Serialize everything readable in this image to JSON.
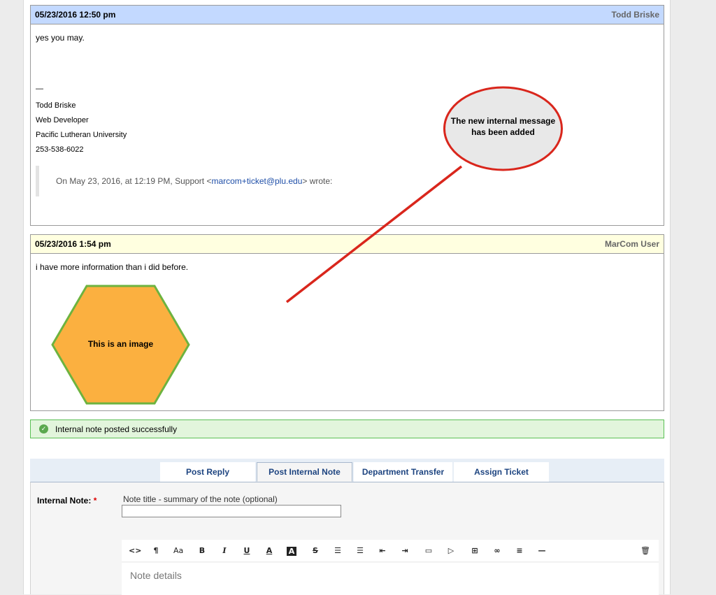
{
  "thread1": {
    "date": "05/23/2016 12:50 pm",
    "author": "Todd Briske",
    "message": "yes you may.",
    "separator": "—",
    "signature": [
      "Todd Briske",
      "Web Developer",
      "Pacific Lutheran University",
      "253-538-6022"
    ],
    "quote_prefix": "On May 23, 2016, at 12:19 PM, Support <",
    "quote_email": "marcom+ticket@plu.edu",
    "quote_suffix": "> wrote:"
  },
  "thread2": {
    "date": "05/23/2016 1:54 pm",
    "author": "MarCom User",
    "message": "i have more information than i did before.",
    "image_label": "This is an image"
  },
  "callout": {
    "text": "The new internal message has been added"
  },
  "alert": {
    "icon": "check-circle-icon",
    "text": "Internal note posted successfully"
  },
  "tabs": [
    {
      "label": "Post Reply",
      "active": false
    },
    {
      "label": "Post Internal Note",
      "active": true
    },
    {
      "label": "Department Transfer",
      "active": false
    },
    {
      "label": "Assign Ticket",
      "active": false
    }
  ],
  "form": {
    "label": "Internal Note:",
    "required_mark": "*",
    "title_hint": "Note title - summary of the note (optional)",
    "title_value": "",
    "details_placeholder": "Note details"
  },
  "toolbar": [
    "code-view-icon",
    "paragraph-icon",
    "font-size-icon",
    "bold-icon",
    "italic-icon",
    "underline-icon",
    "text-color-icon",
    "background-color-icon",
    "strikethrough-icon",
    "unordered-list-icon",
    "ordered-list-icon",
    "outdent-icon",
    "indent-icon",
    "image-icon",
    "video-icon",
    "table-icon",
    "link-icon",
    "align-icon",
    "horizontal-rule-icon",
    "trash-icon"
  ],
  "colors": {
    "response_header": "#c3d9ff",
    "note_header": "#ffffe0",
    "hexagon_fill": "#fbb040",
    "hexagon_stroke": "#6db33f",
    "arrow": "#d9261c",
    "alert_bg": "#e2f5dc",
    "tab_text": "#1d4480"
  }
}
